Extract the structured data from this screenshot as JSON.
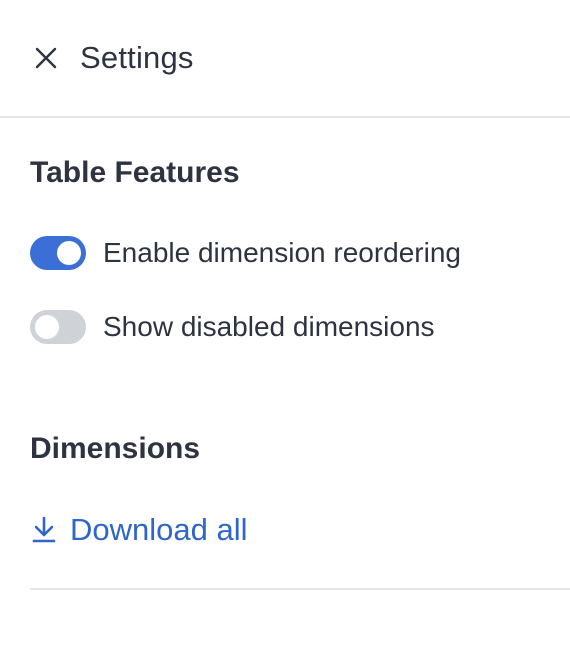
{
  "header": {
    "title": "Settings",
    "close_icon": "close-icon"
  },
  "table_features": {
    "title": "Table Features",
    "toggles": [
      {
        "label": "Enable dimension reordering",
        "checked": true
      },
      {
        "label": "Show disabled dimensions",
        "checked": false
      }
    ]
  },
  "dimensions": {
    "title": "Dimensions",
    "download_label": "Download all",
    "download_icon": "download-icon"
  },
  "colors": {
    "accent": "#3b6fd6",
    "link": "#2f66cc",
    "text": "#2d3340",
    "toggle_off": "#cfd2d7",
    "divider": "#e5e7eb"
  }
}
